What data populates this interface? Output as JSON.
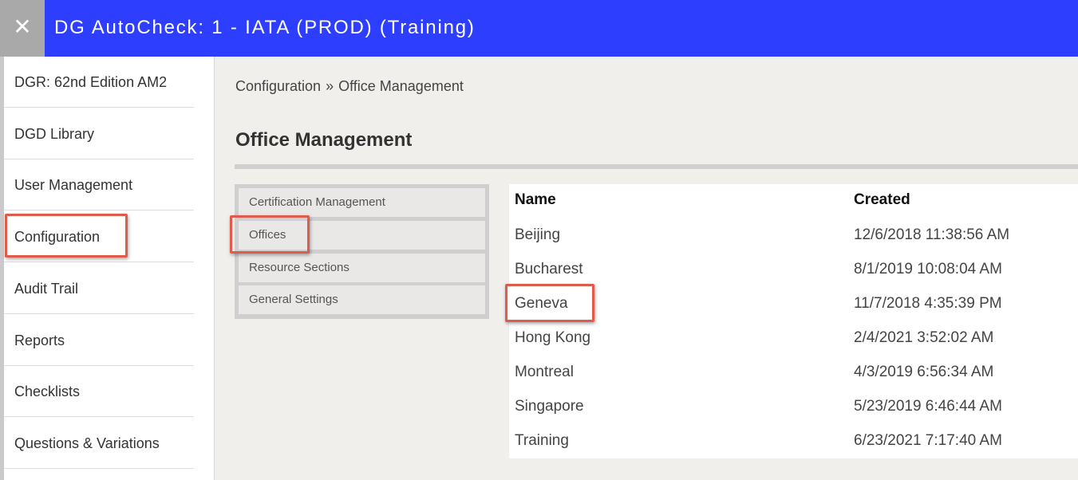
{
  "app": {
    "title": "DG AutoCheck: 1 - IATA (PROD) (Training)",
    "close_symbol": "✕",
    "header_color": "#2d3eff"
  },
  "sidebar": {
    "items": [
      {
        "label": "DGR: 62nd Edition AM2"
      },
      {
        "label": "DGD Library"
      },
      {
        "label": "User Management"
      },
      {
        "label": "Configuration"
      },
      {
        "label": "Audit Trail"
      },
      {
        "label": "Reports"
      },
      {
        "label": "Checklists"
      },
      {
        "label": "Questions & Variations"
      }
    ]
  },
  "breadcrumb": {
    "parent": "Configuration",
    "separator": "»",
    "current": "Office Management"
  },
  "page": {
    "title": "Office Management"
  },
  "submenu": {
    "items": [
      {
        "label": "Certification Management"
      },
      {
        "label": "Offices"
      },
      {
        "label": "Resource Sections"
      },
      {
        "label": "General Settings"
      }
    ]
  },
  "table": {
    "columns": [
      "Name",
      "Created"
    ],
    "rows": [
      {
        "name": "Beijing",
        "created": "12/6/2018 11:38:56 AM"
      },
      {
        "name": "Bucharest",
        "created": "8/1/2019 10:08:04 AM"
      },
      {
        "name": "Geneva",
        "created": "11/7/2018 4:35:39 PM"
      },
      {
        "name": "Hong Kong",
        "created": "2/4/2021 3:52:02 AM"
      },
      {
        "name": "Montreal",
        "created": "4/3/2019 6:56:34 AM"
      },
      {
        "name": "Singapore",
        "created": "5/23/2019 6:46:44 AM"
      },
      {
        "name": "Training",
        "created": "6/23/2021 7:17:40 AM"
      }
    ]
  },
  "highlight_color": "#e05b4c"
}
